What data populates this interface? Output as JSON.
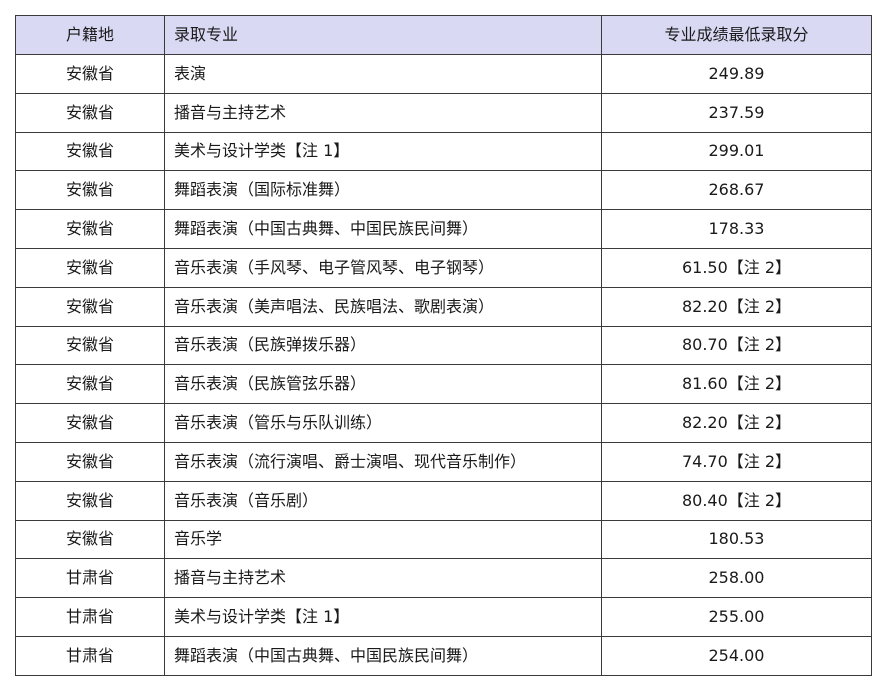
{
  "table": {
    "headers": {
      "region": "户籍地",
      "major": "录取专业",
      "score": "专业成绩最低录取分"
    },
    "rows": [
      {
        "region": "安徽省",
        "major": "表演",
        "score": "249.89"
      },
      {
        "region": "安徽省",
        "major": "播音与主持艺术",
        "score": "237.59"
      },
      {
        "region": "安徽省",
        "major": "美术与设计学类【注 1】",
        "score": "299.01"
      },
      {
        "region": "安徽省",
        "major": "舞蹈表演（国际标准舞）",
        "score": "268.67"
      },
      {
        "region": "安徽省",
        "major": "舞蹈表演（中国古典舞、中国民族民间舞）",
        "score": "178.33"
      },
      {
        "region": "安徽省",
        "major": "音乐表演（手风琴、电子管风琴、电子钢琴）",
        "score": "61.50【注 2】"
      },
      {
        "region": "安徽省",
        "major": "音乐表演（美声唱法、民族唱法、歌剧表演）",
        "score": "82.20【注 2】"
      },
      {
        "region": "安徽省",
        "major": "音乐表演（民族弹拨乐器）",
        "score": "80.70【注 2】"
      },
      {
        "region": "安徽省",
        "major": "音乐表演（民族管弦乐器）",
        "score": "81.60【注 2】"
      },
      {
        "region": "安徽省",
        "major": "音乐表演（管乐与乐队训练）",
        "score": "82.20【注 2】"
      },
      {
        "region": "安徽省",
        "major": "音乐表演（流行演唱、爵士演唱、现代音乐制作）",
        "score": "74.70【注 2】"
      },
      {
        "region": "安徽省",
        "major": "音乐表演（音乐剧）",
        "score": "80.40【注 2】"
      },
      {
        "region": "安徽省",
        "major": "音乐学",
        "score": "180.53"
      },
      {
        "region": "甘肃省",
        "major": "播音与主持艺术",
        "score": "258.00"
      },
      {
        "region": "甘肃省",
        "major": "美术与设计学类【注 1】",
        "score": "255.00"
      },
      {
        "region": "甘肃省",
        "major": "舞蹈表演（中国古典舞、中国民族民间舞）",
        "score": "254.00"
      }
    ]
  }
}
